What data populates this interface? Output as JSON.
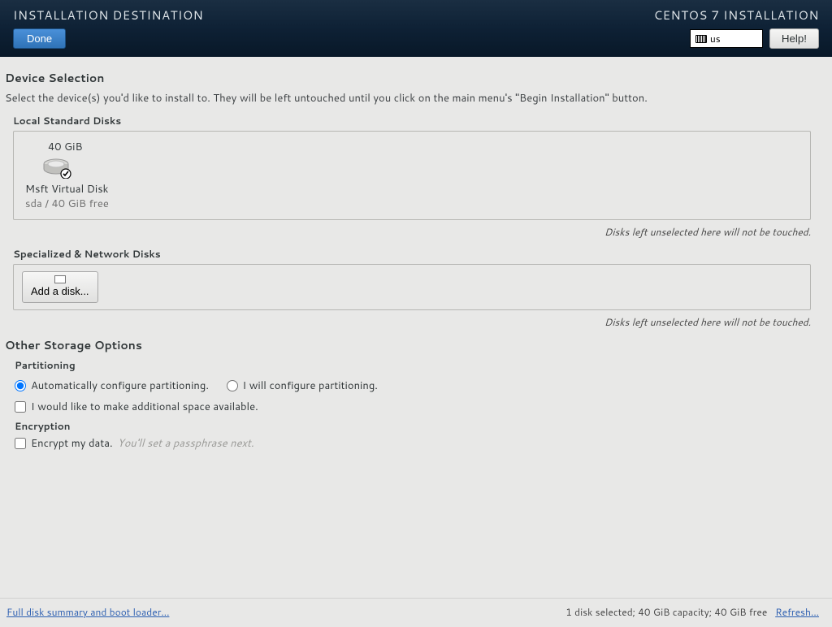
{
  "header": {
    "title": "INSTALLATION DESTINATION",
    "done": "Done",
    "product": "CENTOS 7 INSTALLATION",
    "keyboard": "us",
    "help": "Help!"
  },
  "device_selection": {
    "heading": "Device Selection",
    "instruction": "Select the device(s) you'd like to install to.  They will be left untouched until you click on the main menu's \"Begin Installation\" button."
  },
  "local_disks": {
    "heading": "Local Standard Disks",
    "disk": {
      "size": "40 GiB",
      "name": "Msft Virtual Disk",
      "sub": "sda  /  40 GiB free"
    },
    "note": "Disks left unselected here will not be touched."
  },
  "network_disks": {
    "heading": "Specialized & Network Disks",
    "add_label": "Add a disk...",
    "note": "Disks left unselected here will not be touched."
  },
  "other_options": {
    "heading": "Other Storage Options",
    "partitioning": {
      "label": "Partitioning",
      "auto": "Automatically configure partitioning.",
      "manual": "I will configure partitioning.",
      "reclaim": "I would like to make additional space available."
    },
    "encryption": {
      "label": "Encryption",
      "encrypt": "Encrypt my data.",
      "hint": "You'll set a passphrase next."
    }
  },
  "footer": {
    "summary_link": "Full disk summary and boot loader...",
    "status": "1 disk selected; 40 GiB capacity; 40 GiB free",
    "refresh": "Refresh..."
  }
}
